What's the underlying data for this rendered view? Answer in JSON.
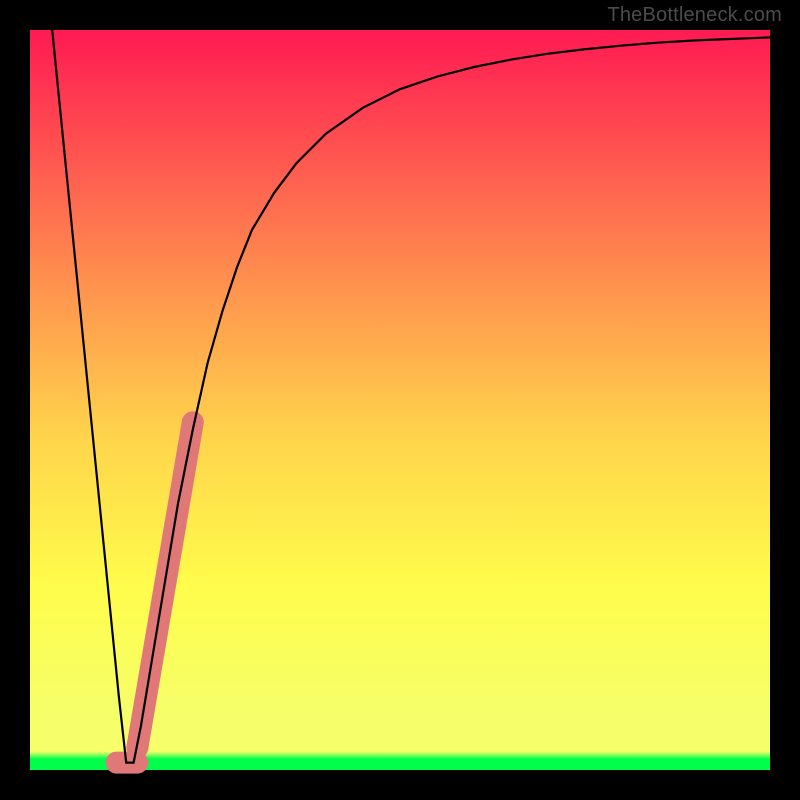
{
  "watermark": "TheBottleneck.com",
  "colors": {
    "frame": "#000000",
    "grad_top": "#ff1a52",
    "grad_mid1": "#ff944e",
    "grad_mid2": "#ffd44c",
    "grad_mid3": "#fffc4b",
    "grad_low": "#f6ff69",
    "grad_green": "#00ff4a",
    "curve": "#000000",
    "highlight": "#e07878"
  },
  "chart_data": {
    "type": "line",
    "title": "",
    "xlabel": "",
    "ylabel": "",
    "xlim": [
      0,
      100
    ],
    "ylim": [
      0,
      100
    ],
    "series": [
      {
        "name": "bottleneck-curve",
        "x": [
          3,
          4,
          5,
          6,
          7,
          8,
          9,
          10,
          11,
          12,
          13,
          14,
          15,
          16,
          18,
          20,
          22,
          24,
          26,
          28,
          30,
          33,
          36,
          40,
          45,
          50,
          55,
          60,
          65,
          70,
          75,
          80,
          85,
          90,
          95,
          100
        ],
        "y": [
          100,
          90,
          80,
          70,
          60,
          50,
          40,
          30,
          20,
          10,
          1,
          1,
          6,
          12,
          24,
          36,
          46,
          55,
          62,
          68,
          73,
          78,
          82,
          86,
          89.5,
          92,
          93.7,
          95,
          96,
          96.8,
          97.4,
          97.9,
          98.3,
          98.6,
          98.8,
          99
        ]
      }
    ],
    "highlight_segment": {
      "name": "salmon-band",
      "x": [
        13.5,
        22
      ],
      "y": [
        1,
        47
      ]
    },
    "min_point": {
      "x": 13.5,
      "y": 1
    }
  }
}
